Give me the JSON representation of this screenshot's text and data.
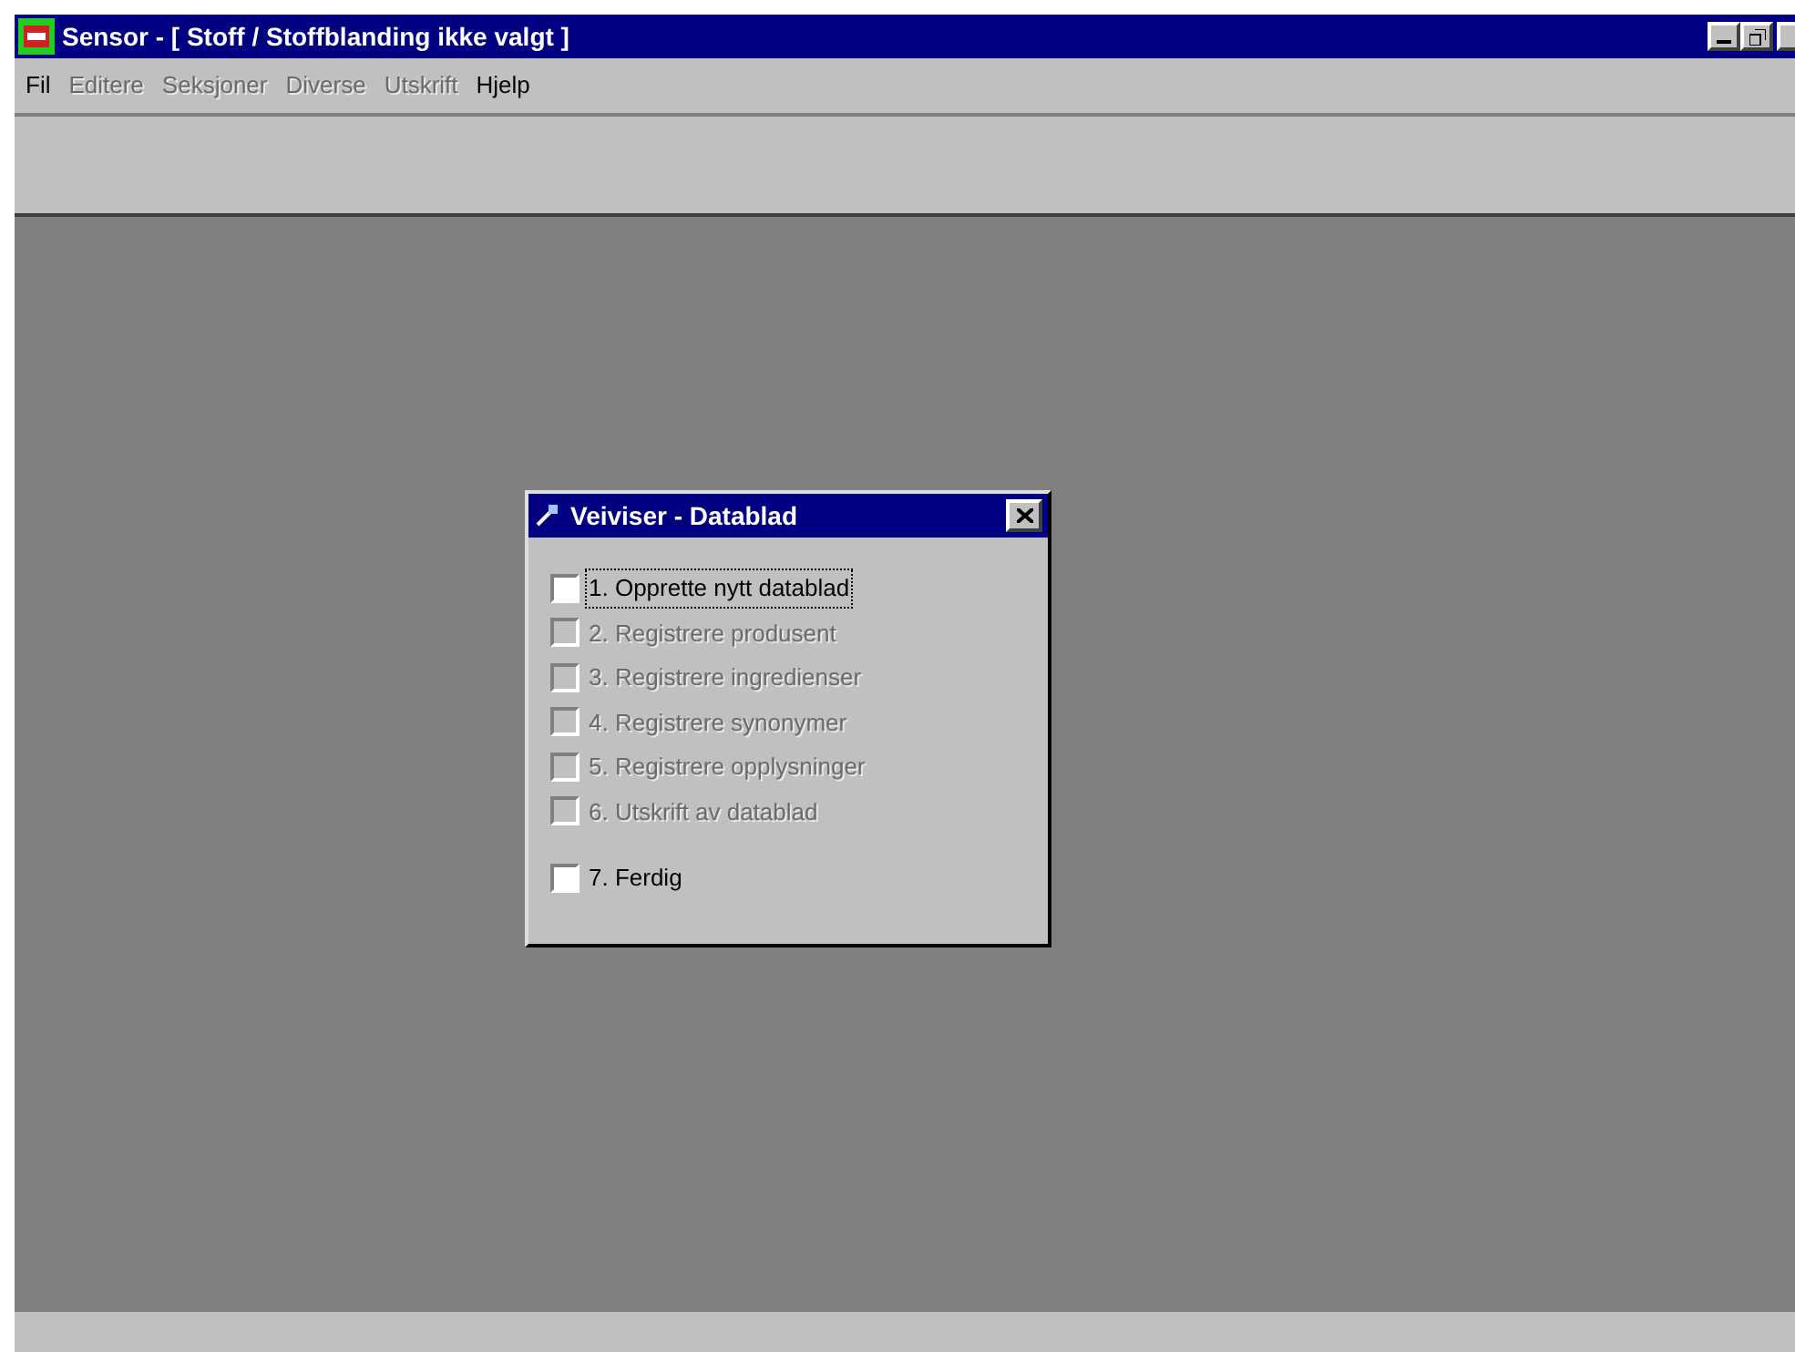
{
  "window": {
    "title": "Sensor - [ Stoff / Stoffblanding ikke valgt ]"
  },
  "menu": [
    {
      "label": "Fil",
      "disabled": false
    },
    {
      "label": "Editere",
      "disabled": true
    },
    {
      "label": "Seksjoner",
      "disabled": true
    },
    {
      "label": "Diverse",
      "disabled": true
    },
    {
      "label": "Utskrift",
      "disabled": true
    },
    {
      "label": "Hjelp",
      "disabled": false
    }
  ],
  "dialog": {
    "title": "Veiviser - Datablad",
    "steps": [
      {
        "label": "1. Opprette nytt datablad",
        "checked": false,
        "disabled": false,
        "focused": true
      },
      {
        "label": "2. Registrere produsent",
        "checked": false,
        "disabled": true,
        "focused": false
      },
      {
        "label": "3. Registrere ingredienser",
        "checked": false,
        "disabled": true,
        "focused": false
      },
      {
        "label": "4. Registrere synonymer",
        "checked": false,
        "disabled": true,
        "focused": false
      },
      {
        "label": "5. Registrere opplysninger",
        "checked": false,
        "disabled": true,
        "focused": false
      },
      {
        "label": "6. Utskrift av datablad",
        "checked": false,
        "disabled": true,
        "focused": false
      },
      {
        "label": "7. Ferdig",
        "checked": false,
        "disabled": false,
        "focused": false
      }
    ]
  }
}
